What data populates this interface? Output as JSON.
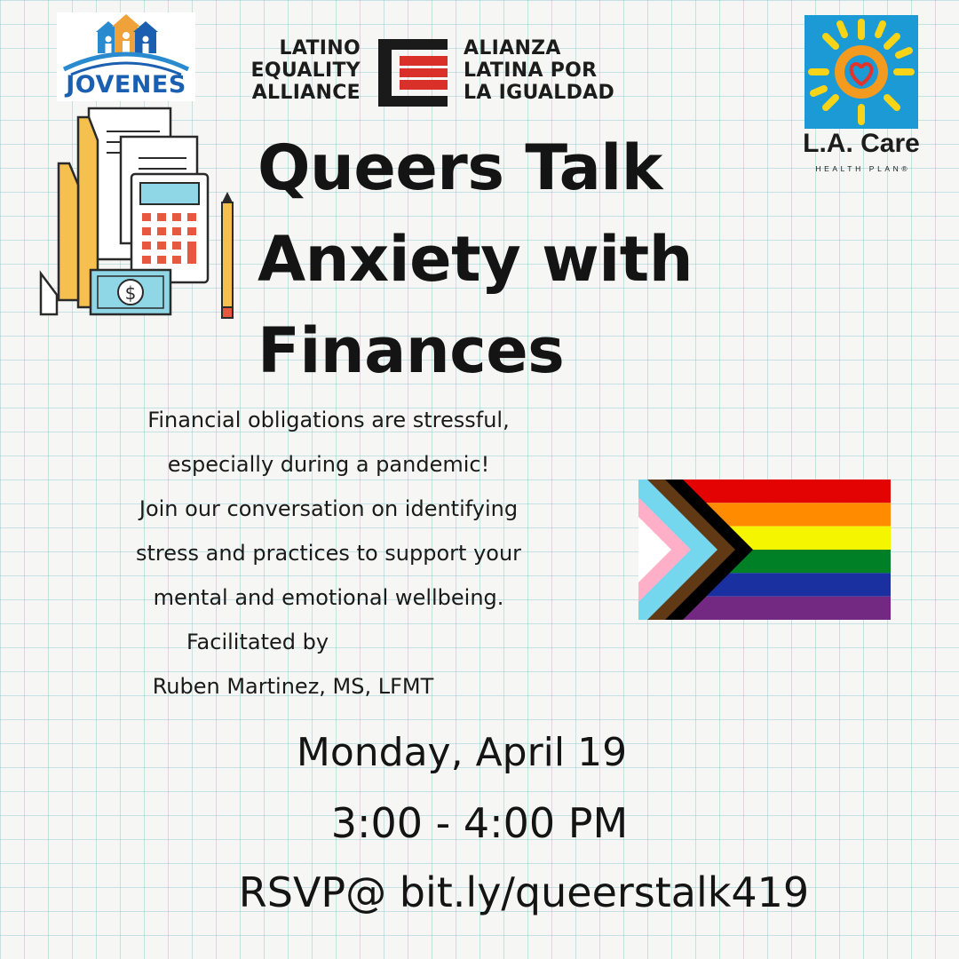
{
  "logos": {
    "jovenes": {
      "name": "JOVENES",
      "color": "#1b5fb0",
      "roof_color": "#f0a23a"
    },
    "lea": {
      "left_lines": [
        "LATINO",
        "EQUALITY",
        "ALLIANCE"
      ],
      "right_lines": [
        "ALIANZA",
        "LATINA POR",
        "LA IGUALDAD"
      ],
      "accent_color": "#d9302a"
    },
    "lacare": {
      "name": "L.A. Care",
      "tagline": "HEALTH PLAN",
      "registered": "®",
      "square_color": "#1b9ad6"
    }
  },
  "title_lines": [
    "Queers Talk",
    "Anxiety with",
    "Finances"
  ],
  "description_lines": [
    "Financial obligations are stressful,",
    "especially during a pandemic!",
    "Join our conversation on identifying",
    "stress and practices to support your",
    "mental and emotional wellbeing.",
    "Facilitated by",
    "Ruben Martinez, MS, LFMT"
  ],
  "event": {
    "date": "Monday, April 19",
    "time": "3:00 - 4:00 PM",
    "rsvp": "RSVP@ bit.ly/queerstalk419"
  },
  "illustration": {
    "icon": "finance-calculator-receipt-icon",
    "currency_symbol": "$"
  },
  "flag": {
    "icon": "progress-pride-flag-icon",
    "stripes": [
      "#e40303",
      "#ff8c00",
      "#f5f500",
      "#008026",
      "#1a30a0",
      "#732982"
    ],
    "chevrons": [
      "#000000",
      "#613915",
      "#74d7ee",
      "#ffafc8",
      "#ffffff"
    ]
  }
}
